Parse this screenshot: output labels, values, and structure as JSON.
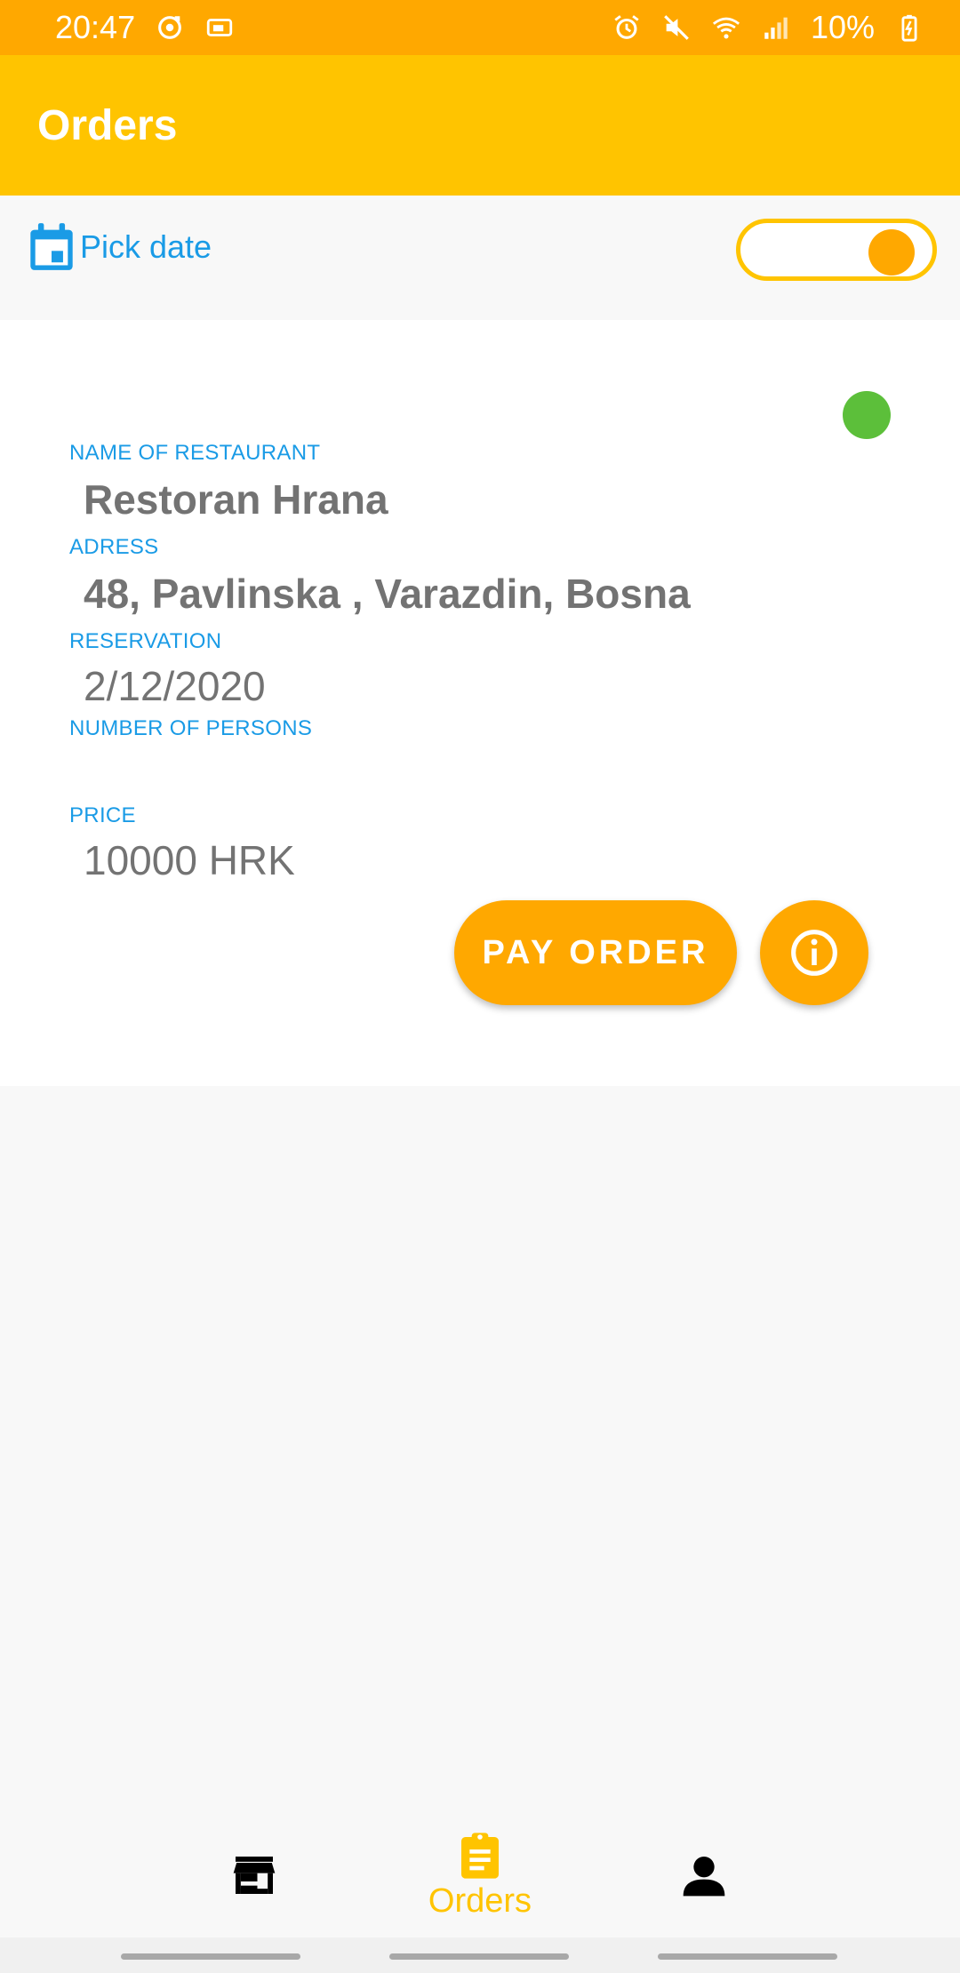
{
  "status_bar": {
    "time": "20:47",
    "battery": "10%",
    "left_icons": [
      "sync-icon",
      "cast-icon"
    ],
    "right_icons": [
      "alarm-icon",
      "mute-icon",
      "wifi-icon",
      "signal-icon",
      "battery-charging-icon"
    ]
  },
  "app_bar": {
    "title": "Orders"
  },
  "toolbar": {
    "pick_date_label": "Pick date",
    "pick_date_icon": "calendar-icon",
    "toggle_on": true
  },
  "order": {
    "status_color": "#5cbf3a",
    "restaurant_label": "NAME OF RESTAURANT",
    "restaurant_value": "Restoran Hrana",
    "address_label": "ADRESS",
    "address_value": "48, Pavlinska , Varazdin, Bosna",
    "reservation_label": "RESERVATION",
    "reservation_value": "2/12/2020",
    "persons_label": "NUMBER OF PERSONS",
    "persons_value": "",
    "price_label": "PRICE",
    "price_value": "10000 HRK",
    "pay_button_label": "PAY ORDER",
    "info_icon": "info-icon"
  },
  "bottom_nav": {
    "items": [
      {
        "icon": "store-icon",
        "label": "",
        "active": false
      },
      {
        "icon": "clipboard-icon",
        "label": "Orders",
        "active": true
      },
      {
        "icon": "person-icon",
        "label": "",
        "active": false
      }
    ]
  },
  "colors": {
    "status_bar": "#ffa800",
    "app_bar": "#ffc400",
    "accent": "#ffa800",
    "label": "#1a9be6",
    "value_text": "#737373"
  }
}
